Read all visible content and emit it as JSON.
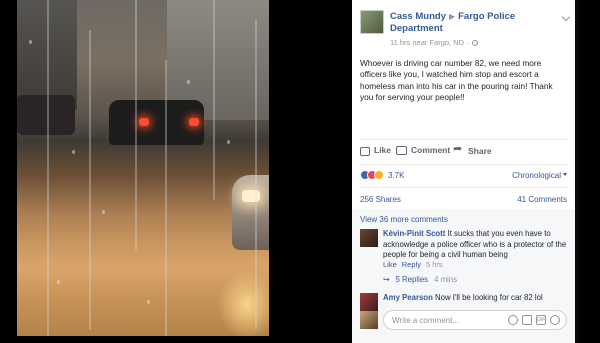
{
  "post": {
    "author": "Cass Mundy",
    "target": "Fargo Police Department",
    "meta": "11 hrs near Fargo, ND ·",
    "text": "Whoever is driving car number 82, we need more officers like you, I watched him stop and escort a homeless man into his car in the pouring rain! Thank you for serving your people!!"
  },
  "actions": {
    "like": "Like",
    "comment": "Comment",
    "share": "Share"
  },
  "reactions": {
    "count": "3.7K",
    "sort": "Chronological"
  },
  "stats": {
    "shares": "256 Shares",
    "comments": "41 Comments"
  },
  "comments": {
    "view_more": "View 36 more comments",
    "items": [
      {
        "name": "Kèvin-Pinit Scott",
        "text": "It sucks that you even have to acknowledge a police officer who is a protector of the people for being a civil human being",
        "like": "Like",
        "reply": "Reply",
        "time": "5 hrs",
        "replies": "5 Replies",
        "replies_time": "4 mins"
      },
      {
        "name": "Amy Pearson",
        "text": "Now I'll be looking for car 82 lol"
      }
    ],
    "placeholder": "Write a comment..."
  },
  "colors": {
    "link": "#365899",
    "text": "#1d2129",
    "muted": "#90949c",
    "bg": "#000000"
  }
}
